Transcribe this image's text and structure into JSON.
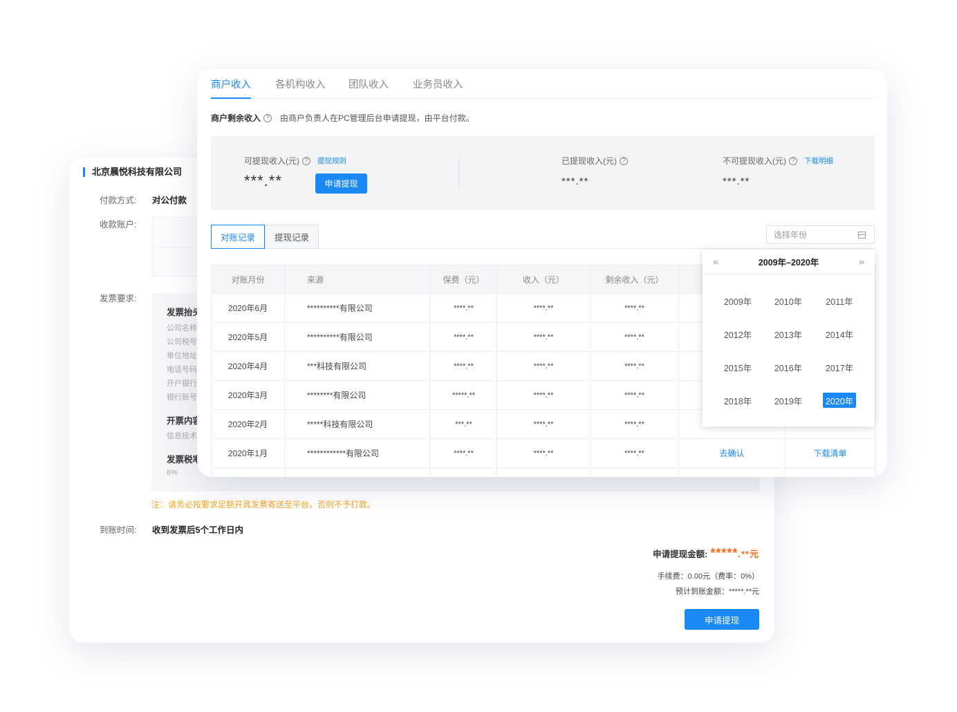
{
  "back_card": {
    "company_name": "北京晨悦科技有限公司",
    "payment_method_label": "付款方式:",
    "payment_method_value": "对公付款",
    "account_label": "收款账户:",
    "invoice_req_label": "发票要求:",
    "invoice_sections": {
      "header_title": "发票抬头",
      "fields": [
        "公司名称",
        "公司税号",
        "单位地址",
        "电话号码",
        "开户银行",
        "银行账号"
      ],
      "content_title": "开票内容",
      "content_value": "信息技术",
      "tax_title": "发票税率",
      "tax_value": "6%"
    },
    "note": "注：请务必按要求足额开具发票寄送至平台，否则不予打款。",
    "arrival_label": "到账时间:",
    "arrival_value": "收到发票后5个工作日内",
    "apply_amount_label": "申请提现金额:",
    "apply_amount_value_main": "*****",
    "apply_amount_value_tail": ".**元",
    "fee_text": "手续费：0.00元（费率：0%）",
    "expected_text": "预计到账金额：*****.**元",
    "apply_button": "申请提现"
  },
  "front_card": {
    "tabs": [
      "商户收入",
      "各机构收入",
      "团队收入",
      "业务员收入"
    ],
    "active_tab": 0,
    "desc_title": "商户剩余收入",
    "desc_text": "由商户负责人在PC管理后台申请提现，由平台付款。",
    "stats": {
      "withdrawable_label": "可提现收入(元)",
      "withdrawable_link": "提现规则",
      "withdrawable_value": "***.**",
      "apply_button": "申请提现",
      "withdrawn_label": "已提现收入(元)",
      "withdrawn_value": "***.**",
      "non_withdrawable_label": "不可提现收入(元)",
      "non_withdrawable_link": "下载明细",
      "non_withdrawable_value": "***.**"
    },
    "subtabs": [
      "对账记录",
      "提现记录"
    ],
    "year_select_placeholder": "选择年份",
    "table": {
      "headers": [
        "对账月份",
        "来源",
        "保费（元）",
        "收入（元）",
        "剩余收入（元）",
        "",
        ""
      ],
      "rows": [
        [
          "2020年6月",
          "**********有限公司",
          "****.**",
          "****.**",
          "****.**",
          "",
          ""
        ],
        [
          "2020年5月",
          "**********有限公司",
          "****.**",
          "****.**",
          "****.**",
          "",
          ""
        ],
        [
          "2020年4月",
          "***科技有限公司",
          "****.**",
          "****.**",
          "****.**",
          "",
          ""
        ],
        [
          "2020年3月",
          "********有限公司",
          "*****.**",
          "****.**",
          "****.**",
          "",
          ""
        ],
        [
          "2020年2月",
          "*****科技有限公司",
          "***.**",
          "****.**",
          "****.**",
          "",
          ""
        ],
        [
          "2020年1月",
          "************有限公司",
          "****.**",
          "****.**",
          "****.**",
          "去确认",
          "下载清单"
        ]
      ]
    }
  },
  "year_picker": {
    "range_title": "2009年–2020年",
    "prev_icon": "«",
    "next_icon": "»",
    "years": [
      "2009年",
      "2010年",
      "2011年",
      "2012年",
      "2013年",
      "2014年",
      "2015年",
      "2016年",
      "2017年",
      "2018年",
      "2019年",
      "2020年"
    ],
    "selected": "2020年",
    "accent_color": "#1a88f5"
  }
}
